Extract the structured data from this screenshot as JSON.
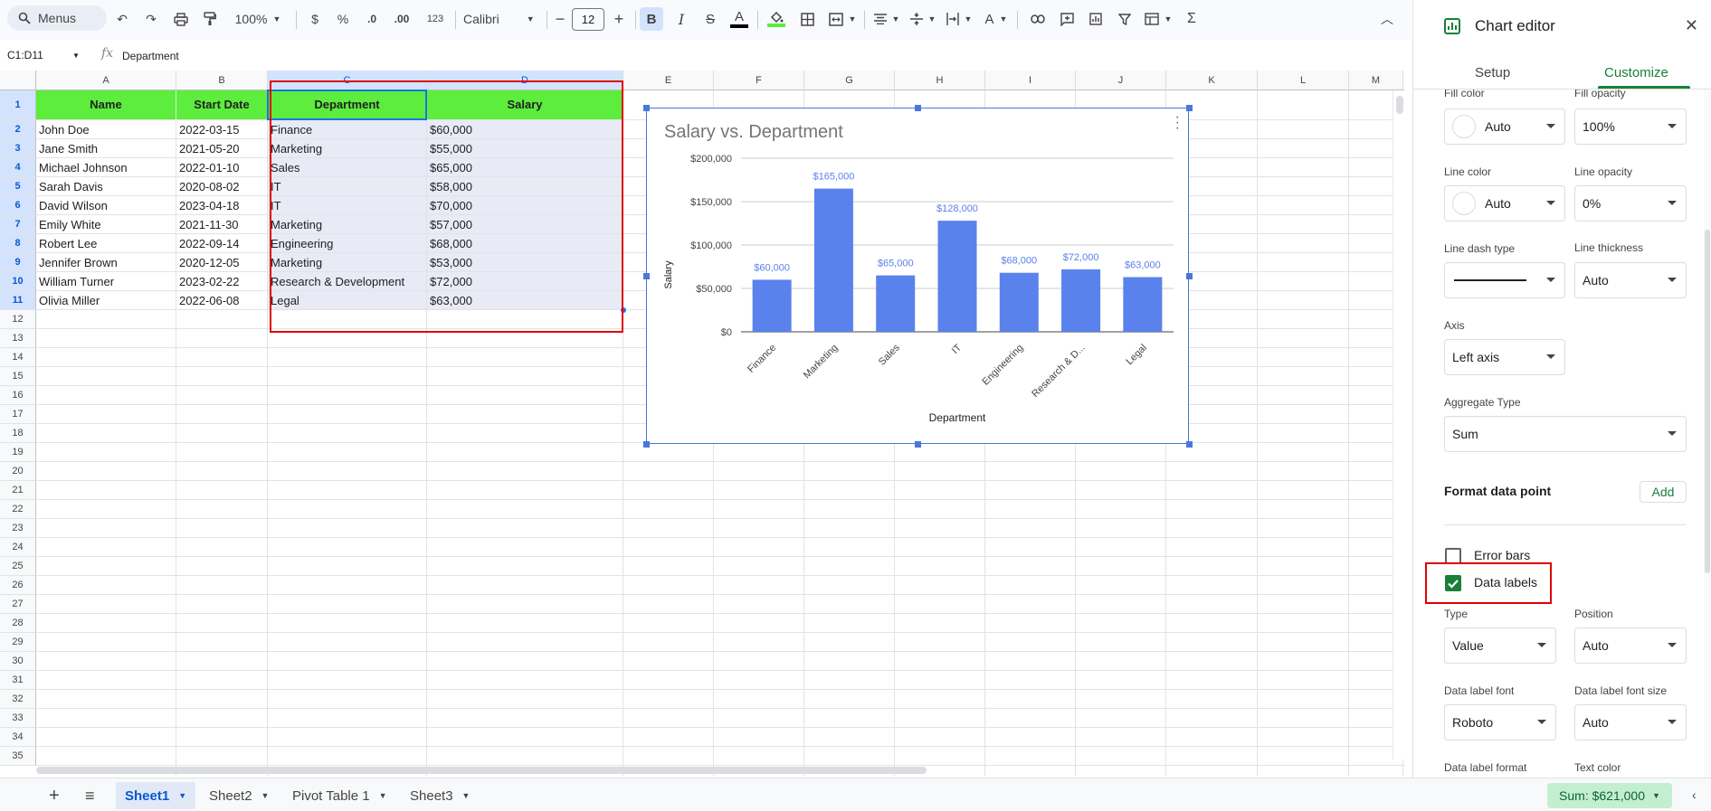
{
  "toolbar": {
    "menus_label": "Menus",
    "zoom": "100%",
    "currency": "$",
    "percent": "%",
    "dec_less": ".0",
    "dec_more": ".00",
    "number_format": "123",
    "font": "Calibri",
    "font_size": "12",
    "bold": "B",
    "italic": "I",
    "function_icon": "Σ"
  },
  "formula_bar": {
    "name_box": "C1:D11",
    "fx": "fx",
    "content": "Department"
  },
  "grid": {
    "columns": [
      "A",
      "B",
      "C",
      "D",
      "E",
      "F",
      "G",
      "H",
      "I",
      "J",
      "K",
      "L",
      "M"
    ],
    "rows": [
      "1",
      "2",
      "3",
      "4",
      "5",
      "6",
      "7",
      "8",
      "9",
      "10",
      "11",
      "12",
      "13",
      "14",
      "15",
      "16",
      "17",
      "18",
      "19",
      "20",
      "21",
      "22",
      "23",
      "24",
      "25",
      "26",
      "27",
      "28",
      "29",
      "30",
      "31",
      "32",
      "33",
      "34",
      "35"
    ],
    "header": [
      "Name",
      "Start Date",
      "Department",
      "Salary"
    ],
    "data": [
      [
        "John Doe",
        "2022-03-15",
        "Finance",
        "$60,000"
      ],
      [
        "Jane Smith",
        "2021-05-20",
        "Marketing",
        "$55,000"
      ],
      [
        "Michael Johnson",
        "2022-01-10",
        "Sales",
        "$65,000"
      ],
      [
        "Sarah Davis",
        "2020-08-02",
        "IT",
        "$58,000"
      ],
      [
        "David Wilson",
        "2023-04-18",
        "IT",
        "$70,000"
      ],
      [
        "Emily White",
        "2021-11-30",
        "Marketing",
        "$57,000"
      ],
      [
        "Robert Lee",
        "2022-09-14",
        "Engineering",
        "$68,000"
      ],
      [
        "Jennifer Brown",
        "2020-12-05",
        "Marketing",
        "$53,000"
      ],
      [
        "William Turner",
        "2023-02-22",
        "Research & Development",
        "$72,000"
      ],
      [
        "Olivia Miller",
        "2022-06-08",
        "Legal",
        "$63,000"
      ]
    ],
    "colors": {
      "header_fill": "#5ded3c",
      "selection": "#e8eaf6",
      "highlight_box": "#e10000"
    }
  },
  "chart_data": {
    "type": "bar",
    "title": "Salary vs. Department",
    "xlabel": "Department",
    "ylabel": "Salary",
    "categories": [
      "Finance",
      "Marketing",
      "Sales",
      "IT",
      "Engineering",
      "Research & D...",
      "Legal"
    ],
    "values": [
      60000,
      165000,
      65000,
      128000,
      68000,
      72000,
      63000
    ],
    "data_labels": [
      "$60,000",
      "$165,000",
      "$65,000",
      "$128,000",
      "$68,000",
      "$72,000",
      "$63,000"
    ],
    "yticks": [
      "$200,000",
      "$150,000",
      "$100,000",
      "$50,000",
      "$0"
    ],
    "ylim": [
      0,
      200000
    ],
    "grid": true,
    "bar_color": "#5a82ec",
    "label_color": "#5a82ec"
  },
  "tabs": {
    "sheets": [
      "Sheet1",
      "Sheet2",
      "Pivot Table 1",
      "Sheet3"
    ],
    "sum": "Sum: $621,000"
  },
  "editor": {
    "title": "Chart editor",
    "tab_setup": "Setup",
    "tab_customize": "Customize",
    "fill_color_label": "Fill color",
    "fill_color_value": "Auto",
    "fill_opacity_label": "Fill opacity",
    "fill_opacity_value": "100%",
    "line_color_label": "Line color",
    "line_color_value": "Auto",
    "line_opacity_label": "Line opacity",
    "line_opacity_value": "0%",
    "line_dash_label": "Line dash type",
    "line_thickness_label": "Line thickness",
    "line_thickness_value": "Auto",
    "axis_label": "Axis",
    "axis_value": "Left axis",
    "aggregate_label": "Aggregate Type",
    "aggregate_value": "Sum",
    "format_point_label": "Format data point",
    "add_label": "Add",
    "error_bars_label": "Error bars",
    "data_labels_label": "Data labels",
    "type_label": "Type",
    "type_value": "Value",
    "position_label": "Position",
    "position_value": "Auto",
    "dl_font_label": "Data label font",
    "dl_font_value": "Roboto",
    "dl_font_size_label": "Data label font size",
    "dl_font_size_value": "Auto",
    "dl_format_label": "Data label format",
    "text_color_label": "Text color"
  }
}
